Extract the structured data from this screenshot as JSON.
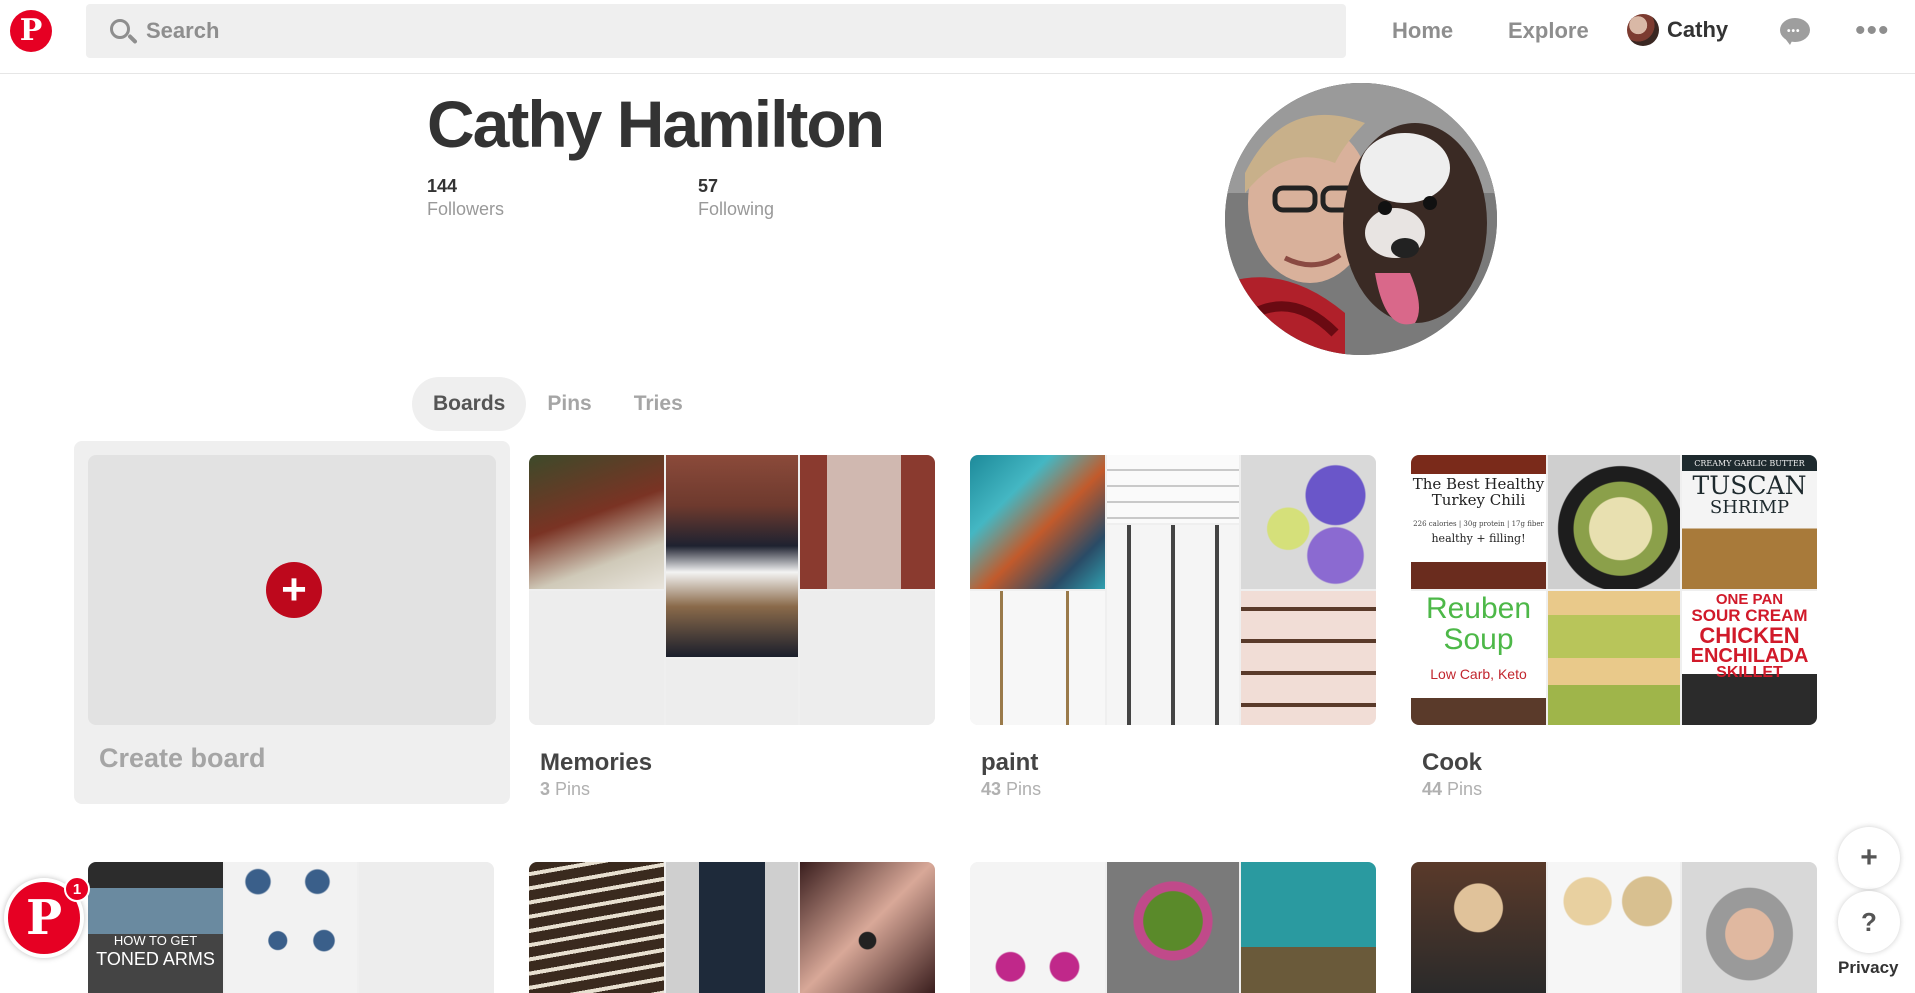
{
  "header": {
    "search_placeholder": "Search",
    "nav": {
      "home": "Home",
      "explore": "Explore",
      "user": "Cathy"
    },
    "brand_color": "#e60023"
  },
  "profile": {
    "name": "Cathy Hamilton",
    "followers_count": "144",
    "followers_label": "Followers",
    "following_count": "57",
    "following_label": "Following"
  },
  "tabs": [
    "Boards",
    "Pins",
    "Tries"
  ],
  "active_tab": "Boards",
  "create_board": {
    "label": "Create board"
  },
  "boards": [
    {
      "title": "Memories",
      "pin_count": "3",
      "pin_label": "Pins"
    },
    {
      "title": "paint",
      "pin_count": "43",
      "pin_label": "Pins"
    },
    {
      "title": "Cook",
      "pin_count": "44",
      "pin_label": "Pins"
    }
  ],
  "cook_pin_texts": {
    "chili_title": "The Best Healthy Turkey Chili",
    "chili_sub": "226 calories | 30g protein | 17g fiber",
    "chili_tag": "healthy + filling!",
    "soup_title_1": "Reuben",
    "soup_title_2": "Soup",
    "soup_sub": "Low Carb, Keto",
    "shrimp_top": "CREAMY GARLIC BUTTER",
    "shrimp_title_1": "TUSCAN",
    "shrimp_title_2": "SHRIMP",
    "skillet_1": "ONE PAN",
    "skillet_2": "SOUR CREAM",
    "skillet_3": "CHICKEN",
    "skillet_4": "ENCHILADA",
    "skillet_5": "SKILLET"
  },
  "row2_pin_text": {
    "arms_1": "HOW TO GET",
    "arms_2": "TONED ARMS"
  },
  "widget": {
    "badge": "1"
  },
  "controls": {
    "plus": "+",
    "help": "?",
    "privacy": "Privacy"
  }
}
